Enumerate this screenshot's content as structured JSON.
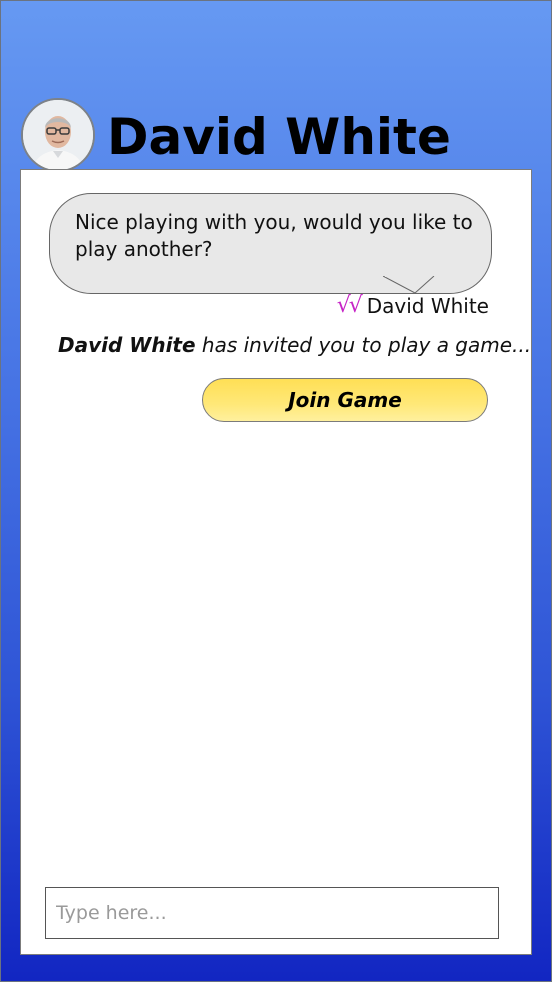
{
  "header": {
    "contact_name": "David White",
    "avatar": "user-avatar-photo"
  },
  "messages": [
    {
      "text": "Nice playing with you, would you like to play another?",
      "sender": "David White",
      "status_icon": "double-check-icon",
      "status_text": "√√",
      "status_color": "#c624c6"
    }
  ],
  "invite": {
    "name": "David White",
    "text": " has invited you to play a game..."
  },
  "join_button": {
    "label": "Join Game"
  },
  "composer": {
    "placeholder": "Type here..."
  },
  "colors": {
    "background_top": "#6699f2",
    "background_bottom": "#1226c2",
    "bubble": "#e8e8e8",
    "button": "#ffe36a"
  }
}
